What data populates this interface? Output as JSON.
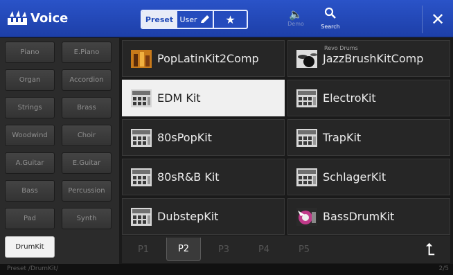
{
  "header": {
    "title": "Voice",
    "logo_icon": "keyboard-voice-icon",
    "tabs": {
      "preset": "Preset",
      "user": "User",
      "favorite_icon": "star-icon"
    },
    "demo_label": "Demo",
    "search_label": "Search",
    "close_icon": "close-icon"
  },
  "categories": [
    "Piano",
    "E.Piano",
    "Organ",
    "Accordion",
    "Strings",
    "Brass",
    "Woodwind",
    "Choir",
    "A.Guitar",
    "E.Guitar",
    "Bass",
    "Percussion",
    "Pad",
    "Synth",
    "DrumKit"
  ],
  "selected_category": "DrumKit",
  "voices": [
    {
      "name": "PopLatinKit2Comp",
      "subtitle": "",
      "icon": "latin-kit-icon"
    },
    {
      "name": "JazzBrushKitComp",
      "subtitle": "Revo Drums",
      "icon": "drum-kit-icon"
    },
    {
      "name": "EDM Kit",
      "subtitle": "",
      "icon": "drum-machine-icon"
    },
    {
      "name": "ElectroKit",
      "subtitle": "",
      "icon": "drum-machine-icon"
    },
    {
      "name": "80sPopKit",
      "subtitle": "",
      "icon": "drum-machine-icon"
    },
    {
      "name": "TrapKit",
      "subtitle": "",
      "icon": "drum-machine-icon"
    },
    {
      "name": "80sR&B Kit",
      "subtitle": "",
      "icon": "drum-machine-icon"
    },
    {
      "name": "SchlagerKit",
      "subtitle": "",
      "icon": "drum-machine-icon"
    },
    {
      "name": "DubstepKit",
      "subtitle": "",
      "icon": "drum-machine-icon"
    },
    {
      "name": "BassDrumKit",
      "subtitle": "",
      "icon": "bass-drum-icon"
    }
  ],
  "selected_voice": "EDM Kit",
  "pages": [
    "P1",
    "P2",
    "P3",
    "P4",
    "P5"
  ],
  "current_page": "P2",
  "up_icon": "up-folder-icon",
  "status": {
    "path": "Preset /DrumKit/",
    "page": "2/5"
  },
  "colors": {
    "header_blue": "#2149bb",
    "selected_bg": "#f0f0f0"
  }
}
